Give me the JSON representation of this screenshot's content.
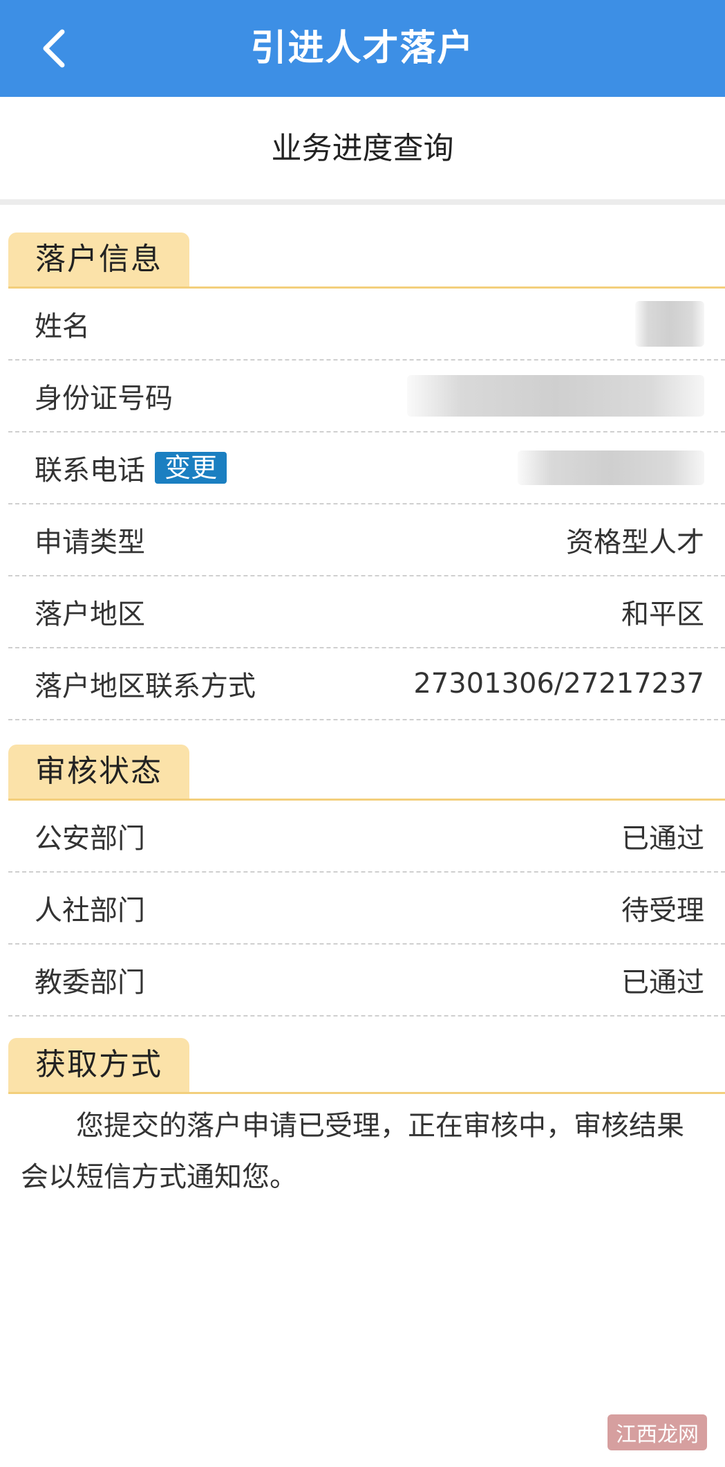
{
  "app_bar": {
    "title": "引进人才落户"
  },
  "sub_header": {
    "title": "业务进度查询"
  },
  "settlement_info": {
    "heading": "落户信息",
    "rows": [
      {
        "label": "姓名",
        "value": ""
      },
      {
        "label": "身份证号码",
        "value": ""
      },
      {
        "label": "联系电话",
        "value": "",
        "action": "变更"
      },
      {
        "label": "申请类型",
        "value": "资格型人才"
      },
      {
        "label": "落户地区",
        "value": "和平区"
      },
      {
        "label": "落户地区联系方式",
        "value": "27301306/27217237"
      }
    ]
  },
  "review_status": {
    "heading": "审核状态",
    "rows": [
      {
        "label": "公安部门",
        "value": "已通过"
      },
      {
        "label": "人社部门",
        "value": "待受理"
      },
      {
        "label": "教委部门",
        "value": "已通过"
      }
    ]
  },
  "retrieval": {
    "heading": "获取方式",
    "notice": "您提交的落户申请已受理，正在审核中，审核结果会以短信方式通知您。"
  },
  "watermark": "江西龙网",
  "colors": {
    "app_bar": "#3d8fe5",
    "section_tab": "#fbe2a9",
    "section_line": "#f3cf7c",
    "change_button": "#1b7fc1"
  }
}
